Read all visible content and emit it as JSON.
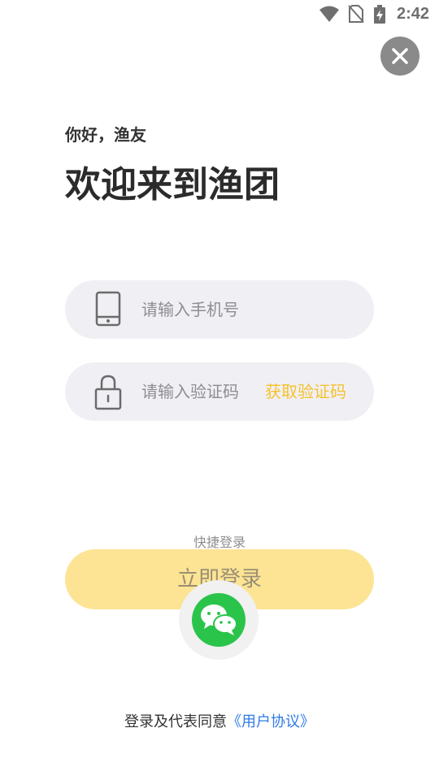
{
  "status_bar": {
    "time": "2:42",
    "icons": [
      "wifi-icon",
      "no-sim-icon",
      "battery-charging-icon"
    ]
  },
  "header": {
    "close_icon": "close-icon",
    "greeting": "你好，渔友",
    "welcome": "欢迎来到渔团"
  },
  "form": {
    "phone": {
      "placeholder": "请输入手机号",
      "icon": "phone-icon",
      "value": ""
    },
    "code": {
      "placeholder": "请输入验证码",
      "icon": "lock-icon",
      "value": "",
      "get_code_label": "获取验证码"
    }
  },
  "actions": {
    "login_label": "立即登录",
    "quick_login_label": "快捷登录",
    "wechat_icon": "wechat-icon"
  },
  "footer": {
    "agreement_prefix": "登录及代表同意",
    "agreement_link": "《用户协议》"
  },
  "colors": {
    "accent": "#f6c12d",
    "login_button": "#fde494",
    "link": "#2f7ae5",
    "wechat": "#2bc44b"
  }
}
